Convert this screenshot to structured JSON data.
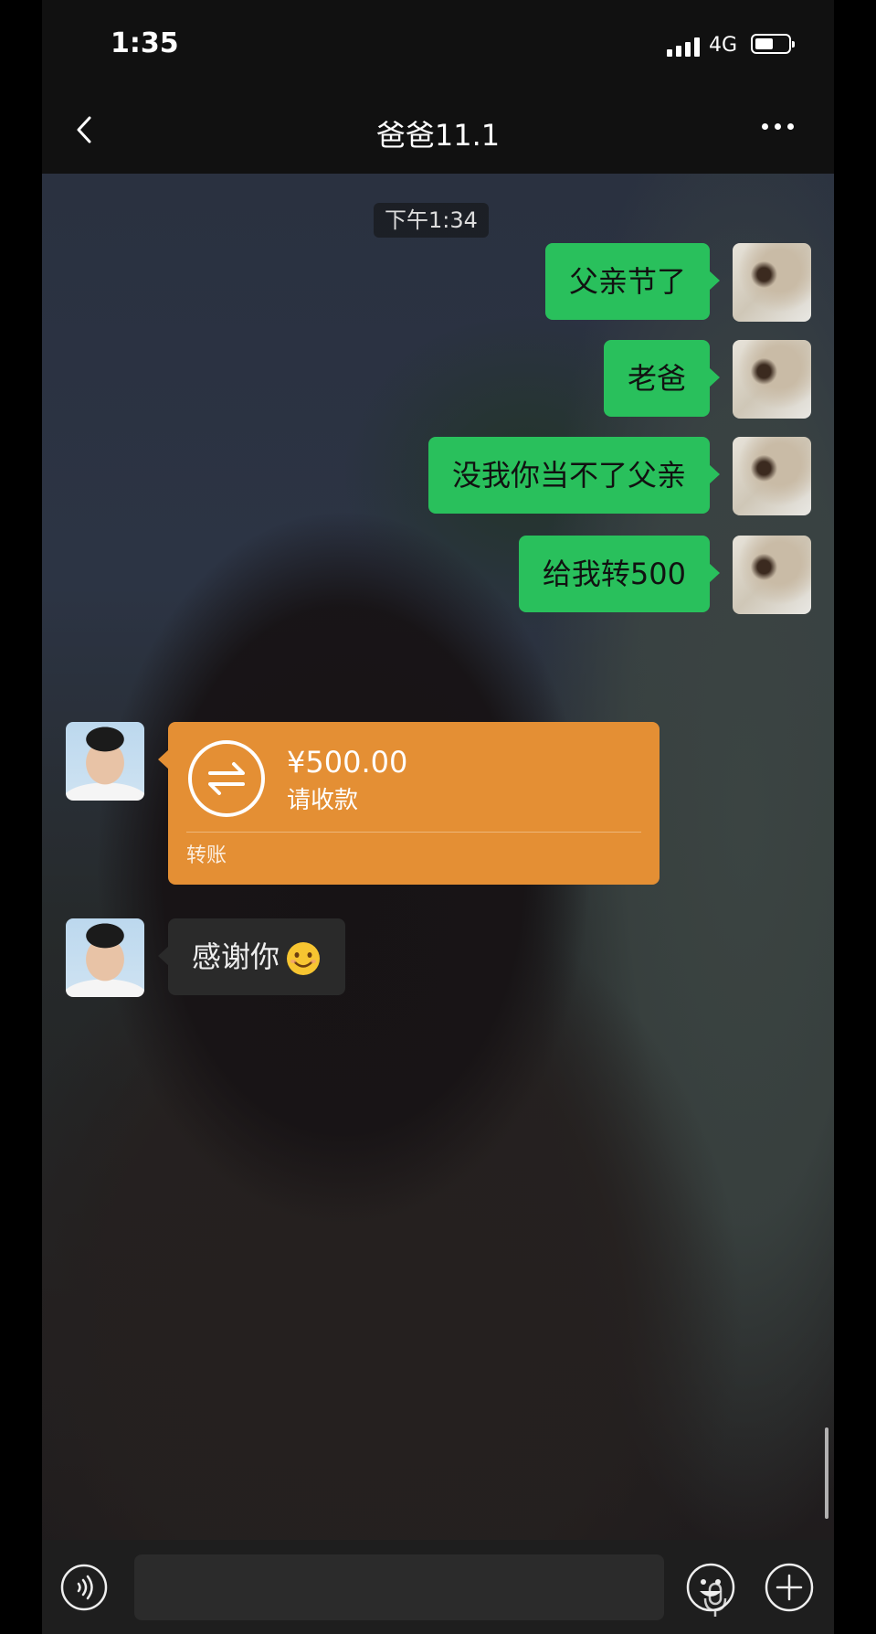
{
  "status_bar": {
    "time": "1:35",
    "network": "4G",
    "battery_level": 0.55
  },
  "header": {
    "title": "爸爸11.1"
  },
  "chat": {
    "timestamp": "下午1:34",
    "messages": [
      {
        "from": "me",
        "text": "父亲节了"
      },
      {
        "from": "me",
        "text": "老爸"
      },
      {
        "from": "me",
        "text": "没我你当不了父亲"
      },
      {
        "from": "me",
        "text": "给我转500"
      },
      {
        "from": "them",
        "type": "transfer",
        "amount": "¥500.00",
        "status": "请收款",
        "label": "转账"
      },
      {
        "from": "them",
        "text": "感谢你",
        "emoji": "smiling-face"
      }
    ]
  },
  "input_bar": {
    "voice_icon": "voice-icon",
    "emoji_icon": "emoji-icon",
    "plus_icon": "plus-icon"
  },
  "colors": {
    "my_bubble": "#29c05c",
    "transfer": "#e48f34",
    "their_bubble": "#2a2a2a",
    "bar": "#111111"
  }
}
